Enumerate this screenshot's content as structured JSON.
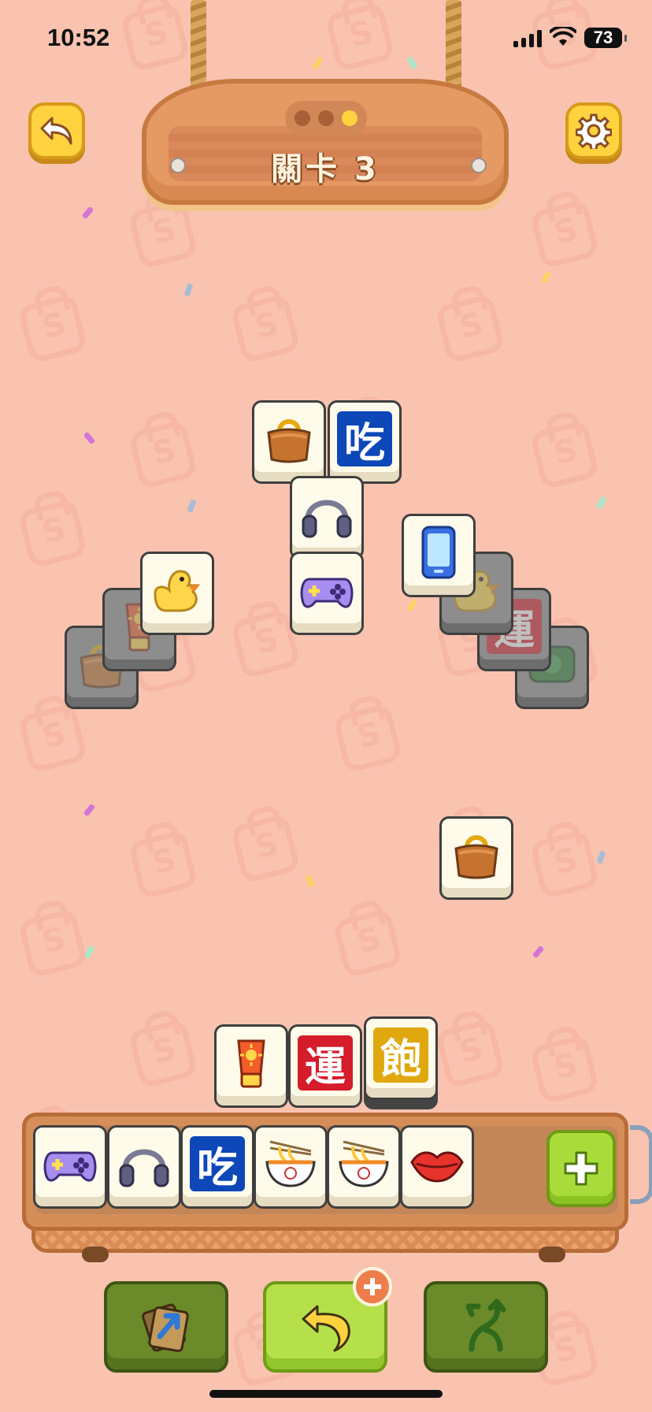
{
  "status_bar": {
    "time": "10:52",
    "battery": "73"
  },
  "header": {
    "level_title": "關卡 3",
    "progress_dots": 3,
    "active_dot": 3
  },
  "board": {
    "tiles": [
      {
        "icon": "handbag-icon",
        "state": "free"
      },
      {
        "icon": "char-tile",
        "char": "吃",
        "state": "free"
      },
      {
        "icon": "headphones-icon",
        "state": "free"
      },
      {
        "icon": "gamepad-icon",
        "state": "free"
      },
      {
        "icon": "phone-icon",
        "state": "free"
      },
      {
        "icon": "duck-icon",
        "state": "free"
      },
      {
        "icon": "sunscreen-icon",
        "state": "blocked"
      },
      {
        "icon": "handbag-icon",
        "state": "blocked"
      },
      {
        "icon": "duck-icon",
        "state": "blocked"
      },
      {
        "icon": "char-tile",
        "char": "運",
        "state": "blocked"
      },
      {
        "icon": "money-icon",
        "state": "blocked"
      },
      {
        "icon": "handbag-icon",
        "state": "free"
      },
      {
        "icon": "sunscreen-icon",
        "state": "free"
      },
      {
        "icon": "char-tile",
        "char": "運",
        "state": "free"
      },
      {
        "icon": "char-tile",
        "char": "飽",
        "state": "free"
      }
    ]
  },
  "tray": {
    "slots": [
      {
        "icon": "gamepad-icon"
      },
      {
        "icon": "headphones-icon"
      },
      {
        "icon": "char-tile",
        "char": "吃"
      },
      {
        "icon": "noodle-bowl-icon"
      },
      {
        "icon": "noodle-bowl-icon"
      },
      {
        "icon": "lips-icon"
      }
    ],
    "capacity": 7
  },
  "powerups": [
    {
      "name": "shuffle",
      "icon": "shuffle-card-icon"
    },
    {
      "name": "undo",
      "icon": "undo-icon"
    },
    {
      "name": "swap",
      "icon": "swap-arrows-icon"
    }
  ],
  "colors": {
    "background": "#f9c3b0",
    "accent_yellow": "#ffd23f",
    "accent_green": "#b6e04a"
  }
}
